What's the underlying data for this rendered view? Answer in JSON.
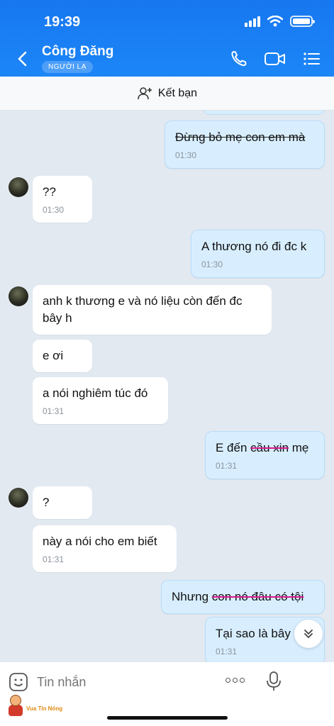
{
  "status_bar": {
    "time": "19:39"
  },
  "header": {
    "contact_name": "Công Đăng",
    "badge": "NGƯỜI LẠ",
    "icons": [
      "back-icon",
      "phone-icon",
      "video-call-icon",
      "menu-list-icon"
    ]
  },
  "friend_bar": {
    "label": "Kết bạn",
    "icon": "add-friend-icon"
  },
  "messages": [
    {
      "dir": "out",
      "text": "Đừng bỏ mẹ con em mà",
      "time": "01:30",
      "struck": true
    },
    {
      "dir": "in",
      "text": "??",
      "time": "01:30"
    },
    {
      "dir": "out",
      "text": "A thương nó đi đc k",
      "time": "01:30"
    },
    {
      "dir": "in",
      "text": "anh k thương e và nó liệu còn đến đc bây h",
      "time": ""
    },
    {
      "dir": "in",
      "text": "e ơi",
      "time": ""
    },
    {
      "dir": "in",
      "text": "a nói nghiêm túc đó",
      "time": "01:31"
    },
    {
      "dir": "out",
      "text_a": "E đến ",
      "text_b": "cầu xin",
      "text_c": " mẹ",
      "time": "01:31"
    },
    {
      "dir": "in",
      "text": "?",
      "time": ""
    },
    {
      "dir": "in",
      "text": "này a nói cho em biết",
      "time": "01:31"
    },
    {
      "dir": "out",
      "text_a": "Nhưng ",
      "text_b": "con nó đâu có tội",
      "time": ""
    },
    {
      "dir": "out",
      "text": "Tại sao là bây",
      "time": "01:31"
    }
  ],
  "input": {
    "placeholder": "Tin nhắn"
  },
  "watermark": {
    "text": "Vua Tin Nóng"
  }
}
